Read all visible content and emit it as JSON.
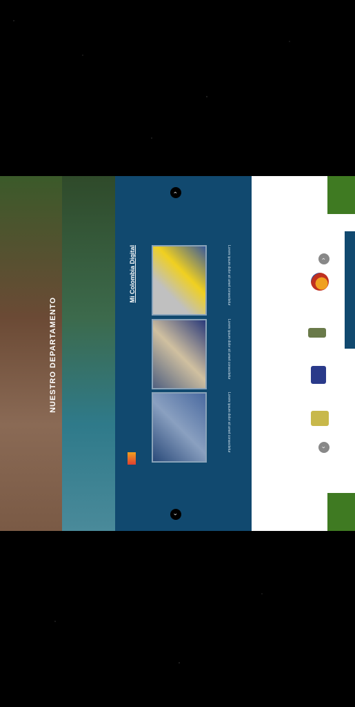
{
  "hero": {
    "title": "NUESTRO DEPARTAMENTO"
  },
  "section": {
    "title": "Mi Colombia Digital"
  },
  "cards": [
    {
      "caption": "Lorem ipsum dolor sit amet consectetur"
    },
    {
      "caption": "Lorem ipsum dolor sit amet consectetur"
    },
    {
      "caption": "Lorem ipsum dolor sit amet consectetur"
    }
  ],
  "colors": {
    "blue": "#11496f",
    "green": "#3f7a22",
    "white": "#ffffff"
  },
  "icons": {
    "prev": "chevron-up-icon",
    "next": "chevron-down-icon"
  }
}
